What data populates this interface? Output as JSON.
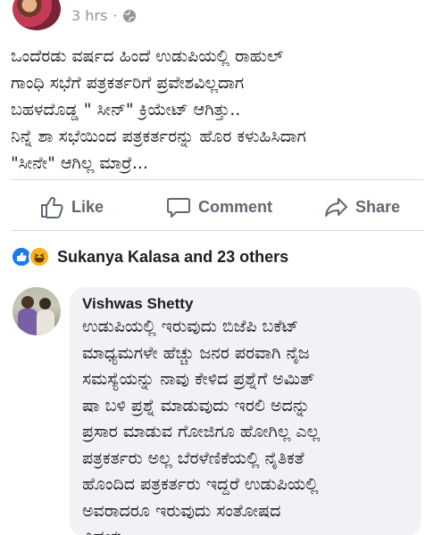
{
  "post": {
    "time": "3 hrs",
    "separator": "·",
    "privacy_icon": "globe-icon",
    "text": "ಒಂದೆರಡು ವರ್ಷದ ಹಿಂದೆ ಉಡುಪಿಯಲ್ಲಿ ರಾಹುಲ್\nಗಾಂಧಿ ಸಭೆಗೆ ಪತ್ರಕರ್ತರಿಗೆ ಪ್ರವೇಶವಿಲ್ಲದಾಗ\nಬಹಳದೊಡ್ಡ \" ಸೀನ್\" ಕ್ರಿಯೇಟ್ ಆಗಿತ್ತು..\nನಿನ್ನೆ ಶಾ ಸಭೆಯಿಂದ ಪತ್ರಕರ್ತರನ್ನು ಹೊರ ಕಳುಹಿಸಿದಾಗ\n\"ಸೀನೇ\" ಆಗಿಲ್ಲ ಮಾರ್ರೆ..."
  },
  "actions": {
    "like": {
      "label": "Like",
      "icon": "thumbs-up-icon"
    },
    "comment": {
      "label": "Comment",
      "icon": "speech-bubble-icon"
    },
    "share": {
      "label": "Share",
      "icon": "share-arrow-icon"
    }
  },
  "reactions": {
    "icons": [
      "like-icon",
      "haha-icon"
    ],
    "summary": "Sukanya Kalasa and 23 others"
  },
  "comment": {
    "author": "Vishwas Shetty",
    "text": "ಉಡುಪಿಯಲ್ಲಿ ಇರುವುದು ಬಿಜೆಪಿ ಬಕೆಟ್\nಮಾಧ್ಯಮಗಳೇ ಹೆಚ್ಚು ಜನರ ಪರವಾಗಿ ನೈಜ\nಸಮಸ್ಯೆಯನ್ನು ನಾವು ಕೇಳಿದ ಪ್ರಶ್ನೆಗೆ ಅಮಿತ್\nಷಾ ಬಳಿ ಪ್ರಶ್ನೆ ಮಾಡುವುದು ಇರಲಿ ಅದನ್ನು\nಪ್ರಸಾರ ಮಾಡುವ ಗೋಜಿಗೂ ಹೋಗಿಲ್ಲ ಎಲ್ಲ\nಪತ್ರಕರ್ತರು ಅಲ್ಲ ಬೆರಳೆಣಿಕೆಯಲ್ಲಿ ನೈತಿಕತೆ\nಹೊಂದಿದ ಪತ್ರಕರ್ತರು ಇದ್ದರೆ ಉಡುಪಿಯಲ್ಲಿ\nಅವರಾದರೂ ಇರುವುದು ಸಂತೋಷದ\nವಿಷಯ"
  },
  "colors": {
    "facebook_blue": "#1877f2",
    "haha_yellow": "#f7b125",
    "muted_text": "#90949c",
    "action_text": "#606770",
    "bubble_bg": "#f0f2f5"
  }
}
